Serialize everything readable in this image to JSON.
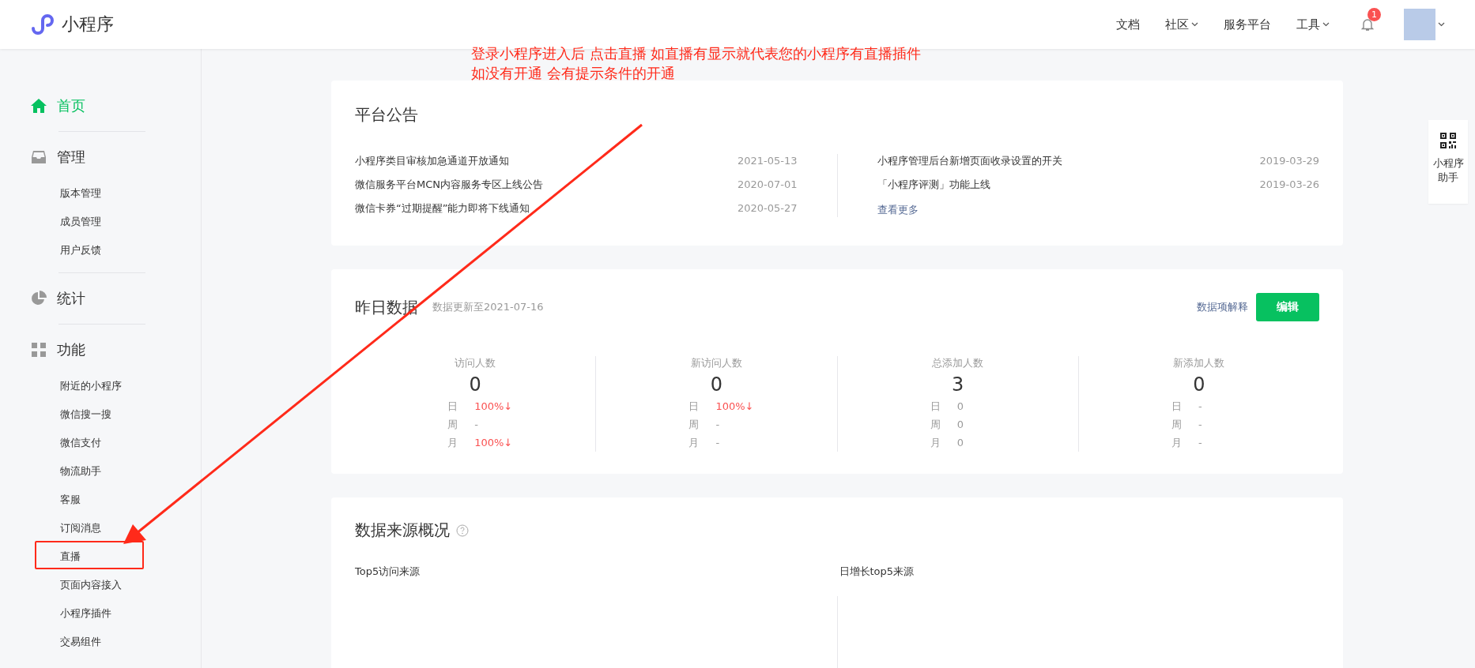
{
  "header": {
    "logo_text": "小程序",
    "nav": [
      {
        "label": "文档",
        "dropdown": false
      },
      {
        "label": "社区",
        "dropdown": true
      },
      {
        "label": "服务平台",
        "dropdown": false
      },
      {
        "label": "工具",
        "dropdown": true
      }
    ],
    "notification_badge": "1"
  },
  "annotation": {
    "lines": [
      "登录小程序进入后 点击直播 如直播有显示就代表您的小程序有直播插件",
      "如没有开通 会有提示条件的开通"
    ]
  },
  "sidebar": {
    "sections": [
      {
        "label": "首页",
        "selected": true
      },
      {
        "label": "管理",
        "selected": false,
        "items": [
          {
            "label": "版本管理",
            "highlighted": false
          },
          {
            "label": "成员管理",
            "highlighted": false
          },
          {
            "label": "用户反馈",
            "highlighted": false
          }
        ]
      },
      {
        "label": "统计",
        "selected": false
      },
      {
        "label": "功能",
        "selected": false,
        "items": [
          {
            "label": "附近的小程序",
            "highlighted": false
          },
          {
            "label": "微信搜一搜",
            "highlighted": false
          },
          {
            "label": "微信支付",
            "highlighted": false
          },
          {
            "label": "物流助手",
            "highlighted": false
          },
          {
            "label": "客服",
            "highlighted": false
          },
          {
            "label": "订阅消息",
            "highlighted": false
          },
          {
            "label": "直播",
            "highlighted": true
          },
          {
            "label": "页面内容接入",
            "highlighted": false
          },
          {
            "label": "小程序插件",
            "highlighted": false
          },
          {
            "label": "交易组件",
            "highlighted": false
          }
        ]
      }
    ]
  },
  "announcements": {
    "title": "平台公告",
    "columns": [
      [
        {
          "text": "小程序类目审核加急通道开放通知",
          "date": "2021-05-13"
        },
        {
          "text": "微信服务平台MCN内容服务专区上线公告",
          "date": "2020-07-01"
        },
        {
          "text": "微信卡券“过期提醒”能力即将下线通知",
          "date": "2020-05-27"
        }
      ],
      [
        {
          "text": "小程序管理后台新增页面收录设置的开关",
          "date": "2019-03-29"
        },
        {
          "text": "「小程序评测」功能上线",
          "date": "2019-03-26"
        }
      ]
    ],
    "more_link": "查看更多"
  },
  "yesterday_data": {
    "title": "昨日数据",
    "updated": "数据更新至2021-07-16",
    "explain_link": "数据项解释",
    "edit_button": "编辑",
    "metrics": [
      {
        "label": "访问人数",
        "value": "0",
        "rows": [
          {
            "period": "日",
            "value": "100%↓",
            "down": true
          },
          {
            "period": "周",
            "value": "-",
            "down": false
          },
          {
            "period": "月",
            "value": "100%↓",
            "down": true
          }
        ]
      },
      {
        "label": "新访问人数",
        "value": "0",
        "rows": [
          {
            "period": "日",
            "value": "100%↓",
            "down": true
          },
          {
            "period": "周",
            "value": "-",
            "down": false
          },
          {
            "period": "月",
            "value": "-",
            "down": false
          }
        ]
      },
      {
        "label": "总添加人数",
        "value": "3",
        "rows": [
          {
            "period": "日",
            "value": "0",
            "down": false
          },
          {
            "period": "周",
            "value": "0",
            "down": false
          },
          {
            "period": "月",
            "value": "0",
            "down": false
          }
        ]
      },
      {
        "label": "新添加人数",
        "value": "0",
        "rows": [
          {
            "period": "日",
            "value": "-",
            "down": false
          },
          {
            "period": "周",
            "value": "-",
            "down": false
          },
          {
            "period": "月",
            "value": "-",
            "down": false
          }
        ]
      }
    ]
  },
  "sources": {
    "title": "数据来源概况",
    "left_label": "Top5访问来源",
    "right_label": "日增长top5来源"
  },
  "helper": {
    "label": "小程序助手"
  }
}
